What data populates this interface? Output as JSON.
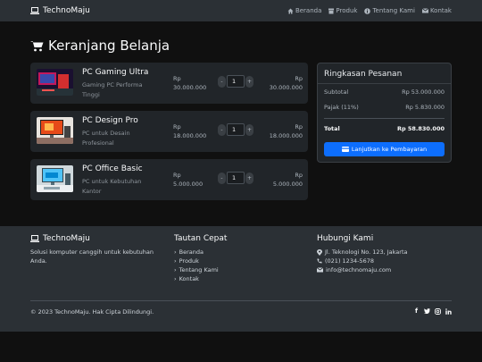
{
  "navbar": {
    "brand": "TechnoMaju",
    "links": [
      "Beranda",
      "Produk",
      "Tentang Kami",
      "Kontak"
    ]
  },
  "page": {
    "title": "Keranjang Belanja"
  },
  "cart": {
    "items": [
      {
        "name": "PC Gaming Ultra",
        "desc": "Gaming PC Performa Tinggi",
        "price_cur": "Rp",
        "price": "30.000.000",
        "qty": "1",
        "subtotal_cur": "Rp",
        "subtotal": "30.000.000"
      },
      {
        "name": "PC Design Pro",
        "desc": "PC untuk Desain Profesional",
        "price_cur": "Rp",
        "price": "18.000.000",
        "qty": "1",
        "subtotal_cur": "Rp",
        "subtotal": "18.000.000"
      },
      {
        "name": "PC Office Basic",
        "desc": "PC untuk Kebutuhan Kantor",
        "price_cur": "Rp",
        "price": "5.000.000",
        "qty": "1",
        "subtotal_cur": "Rp",
        "subtotal": "5.000.000"
      }
    ],
    "minus": "-",
    "plus": "+"
  },
  "summary": {
    "title": "Ringkasan Pesanan",
    "subtotal_label": "Subtotal",
    "subtotal_value": "Rp 53.000.000",
    "tax_label": "Pajak (11%)",
    "tax_value": "Rp 5.830.000",
    "total_label": "Total",
    "total_value": "Rp 58.830.000",
    "checkout_label": "Lanjutkan ke Pembayaran"
  },
  "footer": {
    "brand": "TechnoMaju",
    "tagline": "Solusi komputer canggih untuk kebutuhan Anda.",
    "links_title": "Tautan Cepat",
    "links": [
      "Beranda",
      "Produk",
      "Tentang Kami",
      "Kontak"
    ],
    "contact_title": "Hubungi Kami",
    "address": "Jl. Teknologi No. 123, Jakarta",
    "phone": "(021) 1234-5678",
    "email": "info@technomaju.com",
    "copyright": "© 2023 TechnoMaju. Hak Cipta Dilindungi."
  },
  "colors": {
    "accent": "#0d6efd",
    "navbar": "#2b3035",
    "card": "#212529",
    "background": "#101010"
  }
}
